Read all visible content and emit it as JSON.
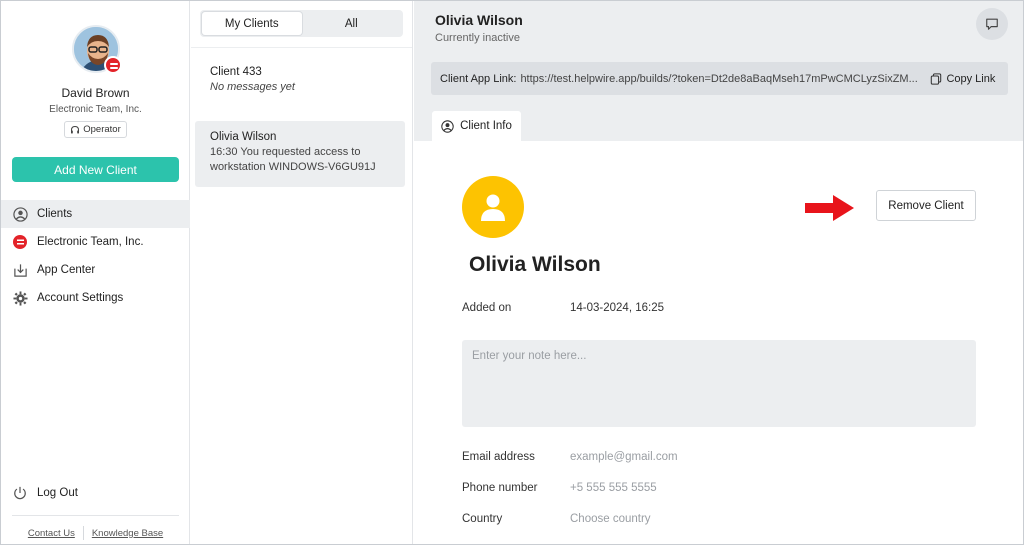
{
  "sidebar": {
    "user": {
      "name": "David Brown",
      "org": "Electronic Team, Inc.",
      "role": "Operator"
    },
    "add_client_label": "Add New Client",
    "nav": [
      {
        "label": "Clients",
        "icon": "user-circle-icon",
        "active": true
      },
      {
        "label": "Electronic Team, Inc.",
        "icon": "org-logo-icon",
        "active": false
      },
      {
        "label": "App Center",
        "icon": "download-icon",
        "active": false
      },
      {
        "label": "Account Settings",
        "icon": "gear-icon",
        "active": false
      }
    ],
    "logout_label": "Log Out",
    "footer": {
      "contact": "Contact Us",
      "kb": "Knowledge Base"
    }
  },
  "list": {
    "tabs": [
      {
        "label": "My Clients",
        "active": true
      },
      {
        "label": "All",
        "active": false
      }
    ],
    "clients": [
      {
        "name": "Client 433",
        "message": "No messages yet",
        "selected": false
      },
      {
        "name": "Olivia Wilson",
        "message": "16:30  You requested access to workstation WINDOWS-V6GU91J",
        "selected": true
      }
    ]
  },
  "main": {
    "title": "Olivia Wilson",
    "status": "Currently inactive",
    "link_label": "Client App Link:",
    "link_url": "https://test.helpwire.app/builds/?token=Dt2de8aBaqMseh17mPwCMCLyzSixZM...",
    "copy_label": "Copy Link",
    "tab_label": "Client Info",
    "client_name": "Olivia Wilson",
    "remove_label": "Remove Client",
    "added_on_label": "Added on",
    "added_on_value": "14-03-2024, 16:25",
    "note_placeholder": "Enter your note here...",
    "email_label": "Email address",
    "email_placeholder": "example@gmail.com",
    "phone_label": "Phone number",
    "phone_placeholder": "+5 555 555 5555",
    "country_label": "Country",
    "country_placeholder": "Choose country"
  },
  "colors": {
    "accent": "#2cc3ac",
    "brand_red": "#e32329",
    "avatar_yellow": "#fdc301",
    "arrow": "#e8141b"
  }
}
